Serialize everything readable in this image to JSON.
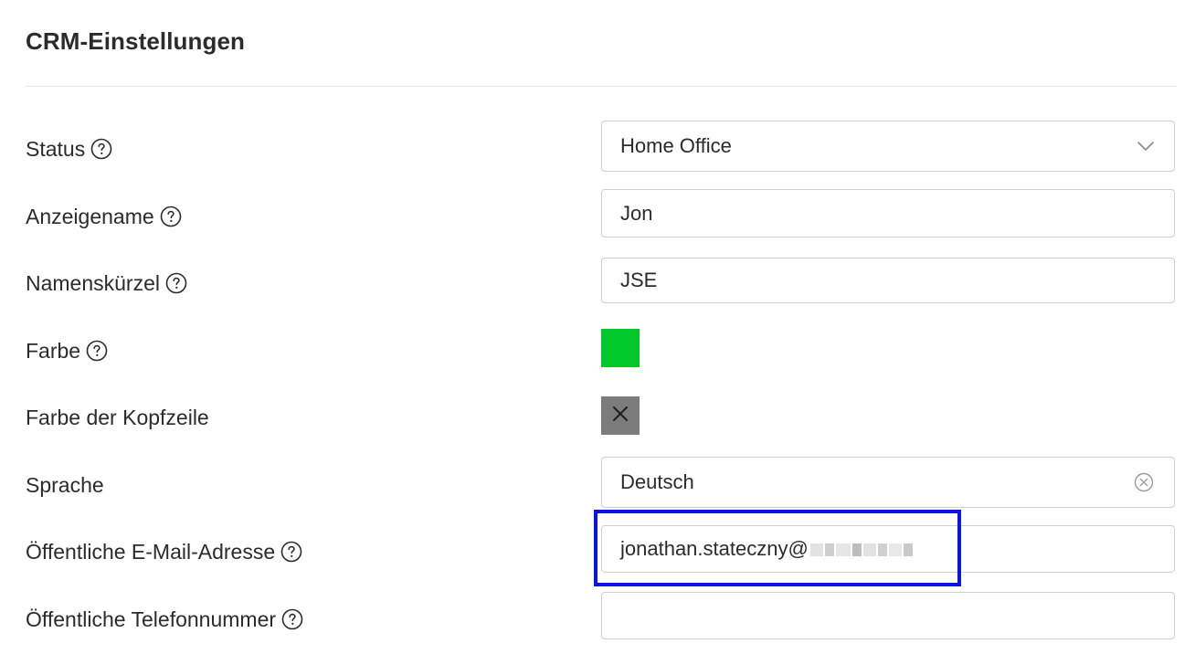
{
  "page": {
    "title": "CRM-Einstellungen"
  },
  "fields": {
    "status": {
      "label": "Status",
      "value": "Home Office",
      "icon": "chevron-down-icon"
    },
    "display_name": {
      "label": "Anzeigename",
      "value": "Jon"
    },
    "initials": {
      "label": "Namenskürzel",
      "value": "JSE"
    },
    "color": {
      "label": "Farbe",
      "value_color": "#00c82a"
    },
    "header_color": {
      "label": "Farbe der Kopfzeile",
      "icon": "close-icon",
      "swatch_color": "#7c7c7c"
    },
    "language": {
      "label": "Sprache",
      "value": "Deutsch",
      "icon": "clear-circle-icon"
    },
    "public_email": {
      "label": "Öffentliche E-Mail-Adresse",
      "value": "jonathan.stateczny@"
    },
    "public_phone": {
      "label": "Öffentliche Telefonnummer",
      "value": ""
    }
  },
  "colors": {
    "highlight_border": "#0b14e6",
    "field_border": "#cfcfcf",
    "text": "#2b2b2b"
  }
}
